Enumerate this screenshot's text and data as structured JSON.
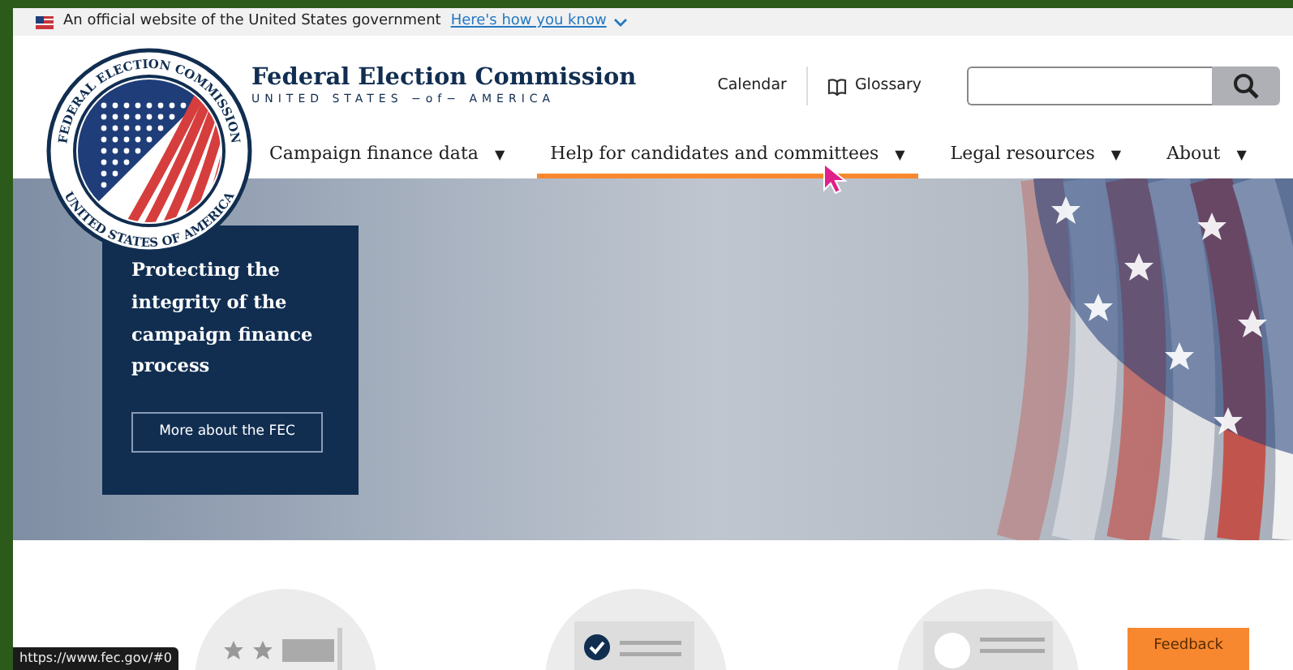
{
  "gov_banner": {
    "text": "An official website of the United States government",
    "link": "Here's how you know"
  },
  "seal": {
    "top_text": "FEDERAL ELECTION COMMISSION",
    "bottom_text": "UNITED STATES OF AMERICA"
  },
  "header": {
    "title": "Federal Election Commission",
    "subtitle": "UNITED STATES −of− AMERICA",
    "utility_links": [
      {
        "label": "Calendar",
        "kind": "text"
      },
      {
        "label": "Glossary",
        "kind": "book"
      }
    ]
  },
  "nav": [
    {
      "label": "Campaign finance data",
      "caret": "▼",
      "selected": false
    },
    {
      "label": "Help for candidates and committees",
      "caret": "▼",
      "selected": true
    },
    {
      "label": "Legal resources",
      "caret": "▼",
      "selected": false
    },
    {
      "label": "About",
      "caret": "▼",
      "selected": false
    }
  ],
  "hero": {
    "heading": "Protecting the integrity of the campaign finance process",
    "button": "More about the FEC"
  },
  "features": [
    {
      "kind": "stars"
    },
    {
      "kind": "check"
    },
    {
      "kind": "section"
    }
  ],
  "status_url": "https://www.fec.gov/#0",
  "feedback": "Feedback"
}
